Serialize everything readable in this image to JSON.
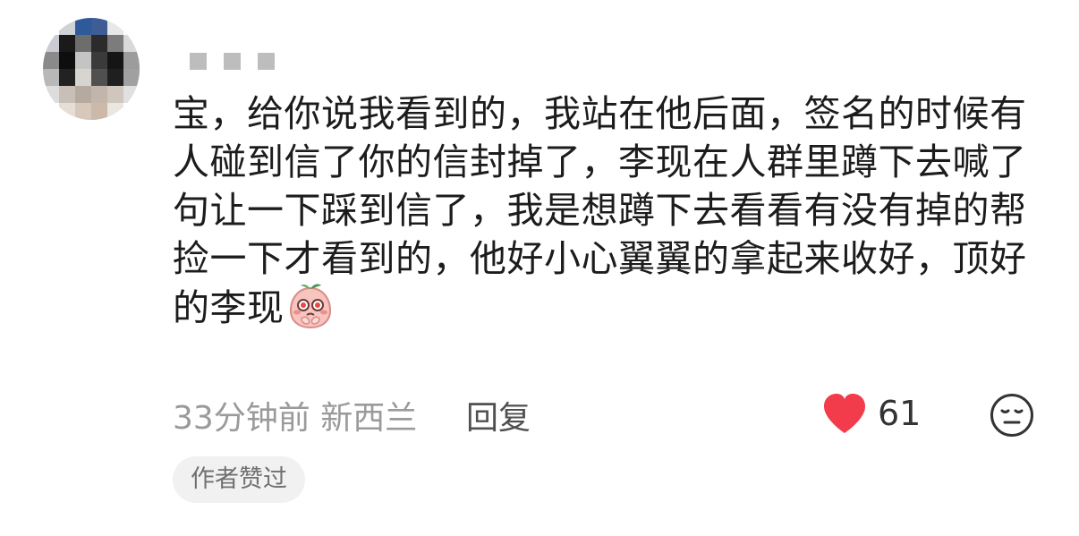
{
  "comment": {
    "text": "宝，给你说我看到的，我站在他后面，签名的时候有人碰到信了你的信封掉了，李现在人群里蹲下去喊了句让一下踩到信了，我是想蹲下去看看有没有掉的帮捡一下才看到的，他好小心翼翼的拿起来收好，顶好的李现",
    "sticker_icon": "blushing-peach-sticker-icon",
    "time_location": "33分钟前 新西兰",
    "reply_label": "回复",
    "like_icon": "heart-icon",
    "like_color": "#f23b4b",
    "like_count": "61",
    "dislike_icon": "meh-face-icon",
    "author_badge": "作者赞过"
  }
}
